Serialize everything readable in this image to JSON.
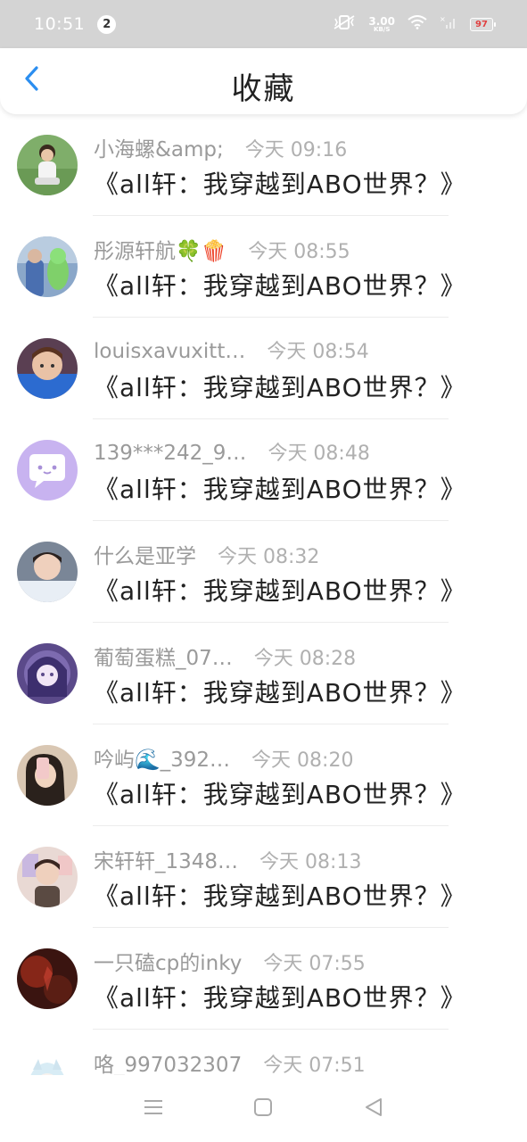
{
  "status_bar": {
    "time": "10:51",
    "notification_count": "2",
    "net_speed_value": "3.00",
    "net_speed_unit": "KB/S",
    "battery": "97"
  },
  "header": {
    "title": "收藏"
  },
  "colors": {
    "accent": "#2b8ef0",
    "status_bar": "#d4d4d4",
    "username": "#9a9a9a",
    "time": "#b0b0b0"
  },
  "items": [
    {
      "username": "小海螺&amp;",
      "time": "今天 09:16",
      "book": "《all轩：我穿越到ABO世界？》"
    },
    {
      "username": "彤源轩航🍀🍿",
      "time": "今天 08:55",
      "book": "《all轩：我穿越到ABO世界？》"
    },
    {
      "username": "louisxavuxitt…",
      "time": "今天 08:54",
      "book": "《all轩：我穿越到ABO世界？》"
    },
    {
      "username": "139***242_9…",
      "time": "今天 08:48",
      "book": "《all轩：我穿越到ABO世界？》"
    },
    {
      "username": "什么是亚学",
      "time": "今天 08:32",
      "book": "《all轩：我穿越到ABO世界？》"
    },
    {
      "username": "葡萄蛋糕_07…",
      "time": "今天 08:28",
      "book": "《all轩：我穿越到ABO世界？》"
    },
    {
      "username": "吟屿🌊_392…",
      "time": "今天 08:20",
      "book": "《all轩：我穿越到ABO世界？》"
    },
    {
      "username": "宋轩轩_1348…",
      "time": "今天 08:13",
      "book": "《all轩：我穿越到ABO世界？》"
    },
    {
      "username": "一只磕cp的inky",
      "time": "今天 07:55",
      "book": "《all轩：我穿越到ABO世界？》"
    },
    {
      "username": "咯_997032307",
      "time": "今天 07:51",
      "book": ""
    }
  ]
}
